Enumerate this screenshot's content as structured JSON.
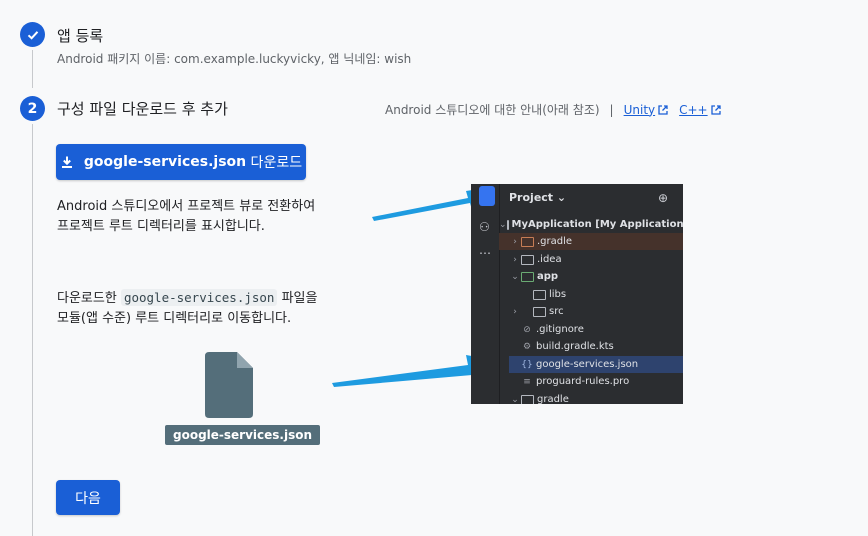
{
  "steps": [
    {
      "number": "✓",
      "title": "앱 등록",
      "subtitle": "Android 패키지 이름: com.example.luckyvicky, 앱 닉네임: wish"
    },
    {
      "number": "2",
      "title": "구성 파일 다운로드 후 추가",
      "help": {
        "text": "Android 스튜디오에 대한 안내(아래 참조)",
        "separator": "|",
        "links": [
          "Unity",
          "C++"
        ]
      }
    }
  ],
  "download_button": {
    "filename": "google-services.json",
    "suffix": " 다운로드"
  },
  "instructions": {
    "para1_line1": "Android 스튜디오에서 프로젝트 뷰로 전환하여",
    "para1_line2": "프로젝트 루트 디렉터리를 표시합니다.",
    "para2_prefix": "다운로드한 ",
    "para2_code": "google-services.json",
    "para2_suffix": " 파일을",
    "para2_line2": "모듈(앱 수준) 루트 디렉터리로 이동합니다."
  },
  "file_illustration": {
    "label": "google-services.json"
  },
  "ide": {
    "header": "Project ⌄",
    "rows": [
      {
        "name": "MyApplication [My Application]",
        "bold_part": "[My Application]"
      },
      {
        "name": ".gradle"
      },
      {
        "name": ".idea"
      },
      {
        "name": "app"
      },
      {
        "name": "libs"
      },
      {
        "name": "src"
      },
      {
        "name": ".gitignore"
      },
      {
        "name": "build.gradle.kts"
      },
      {
        "name": "google-services.json"
      },
      {
        "name": "proguard-rules.pro"
      },
      {
        "name": "gradle"
      }
    ]
  },
  "next_button": {
    "label": "다음"
  },
  "colors": {
    "primary": "#1a5fd6",
    "background": "#f8f9fa",
    "arrow": "#1e9be0",
    "ide_bg": "#2b2d30",
    "file_icon": "#546e7a"
  }
}
